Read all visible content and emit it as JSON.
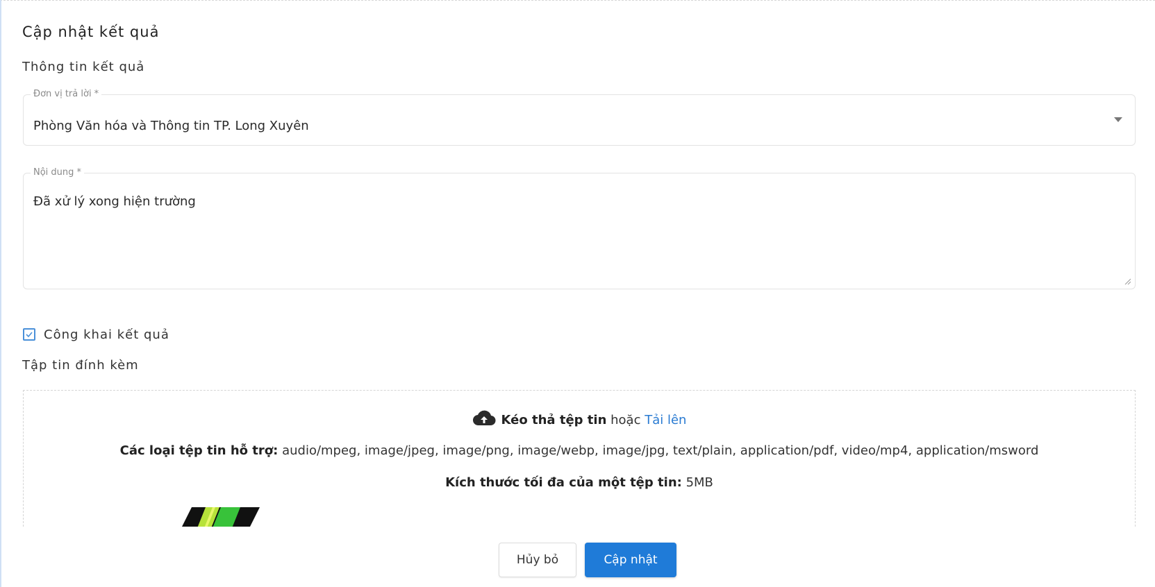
{
  "dialog": {
    "title": "Cập nhật kết quả",
    "section_title": "Thông tin kết quả"
  },
  "responder_unit": {
    "label": "Đơn vị trả lời *",
    "value": "Phòng Văn hóa và Thông tin TP. Long Xuyên"
  },
  "content": {
    "label": "Nội dung *",
    "value": "Đã xử lý xong hiện trường"
  },
  "publish_result": {
    "label": "Công khai kết quả",
    "checked": true
  },
  "attachments": {
    "title": "Tập tin đính kèm",
    "drop_bold": "Kéo thả tệp tin",
    "drop_or": "hoặc",
    "upload_link": "Tải lên",
    "types_label": "Các loại tệp tin hỗ trợ:",
    "types_value": "audio/mpeg, image/jpeg, image/png, image/webp, image/jpg, text/plain, application/pdf, video/mp4, application/msword",
    "max_size_label": "Kích thước tối đa của một tệp tin:",
    "max_size_value": "5MB"
  },
  "actions": {
    "cancel_label": "Hủy bỏ",
    "submit_label": "Cập nhật"
  },
  "colors": {
    "accent": "#1f7bd8",
    "link": "#2a7bd2",
    "checkbox": "#4a90d9"
  },
  "icons": {
    "dropdown": "chevron-down-icon",
    "upload": "cloud-upload-icon",
    "check": "check-icon",
    "resize": "resize-handle-icon"
  }
}
